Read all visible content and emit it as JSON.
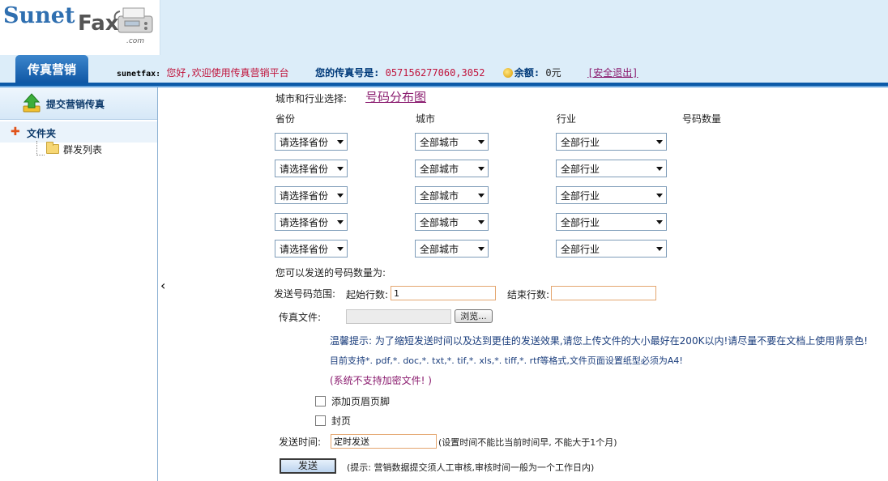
{
  "header": {
    "logo_primary": "Sunet",
    "logo_secondary": "Fax",
    "logo_suffix": ".com",
    "nav_tab": "传真营销",
    "username": "sunetfax:",
    "greeting": "您好,欢迎使用传真营销平台",
    "fax_number_label": "您的传真号是:",
    "fax_number_value": "057156277060,3052",
    "balance_label": "余额:",
    "balance_value": "0元",
    "logout": "[安全退出]"
  },
  "sidebar": {
    "submit_fax": "提交营销传真",
    "folder": "文件夹",
    "items": [
      "群发列表"
    ]
  },
  "form": {
    "selection_label": "城市和行业选择:",
    "map_link": "号码分布图",
    "columns": {
      "province": "省份",
      "city": "城市",
      "industry": "行业",
      "count": "号码数量"
    },
    "rows": [
      {
        "province": "请选择省份",
        "city": "全部城市",
        "industry": "全部行业"
      },
      {
        "province": "请选择省份",
        "city": "全部城市",
        "industry": "全部行业"
      },
      {
        "province": "请选择省份",
        "city": "全部城市",
        "industry": "全部行业"
      },
      {
        "province": "请选择省份",
        "city": "全部城市",
        "industry": "全部行业"
      },
      {
        "province": "请选择省份",
        "city": "全部城市",
        "industry": "全部行业"
      }
    ],
    "sendable_count_label": "您可以发送的号码数量为:",
    "range_label": "发送号码范围:",
    "start_row_label": "起始行数:",
    "start_row_value": "1",
    "end_row_label": "结束行数:",
    "end_row_value": "",
    "fax_file_label": "传真文件:",
    "browse_button": "浏览...",
    "tip_1": "温馨提示: 为了缩短发送时间以及达到更佳的发送效果,请您上传文件的大小最好在200K以内!请尽量不要在文档上使用背景色!",
    "tip_2": "目前支持*. pdf,*. doc,*. txt,*. tif,*. xls,*. tiff,*. rtf等格式,文件页面设置纸型必须为A4!",
    "tip_3": "(系统不支持加密文件! )",
    "checkbox_header_footer": "添加页眉页脚",
    "checkbox_cover": "封页",
    "send_time_label": "发送时间:",
    "send_time_value": "定时发送",
    "send_time_hint": "(设置时间不能比当前时间早, 不能大于1个月)",
    "send_button": "发送",
    "send_hint": "(提示: 营销数据提交须人工审核,审核时间一般为一个工作日内)"
  },
  "colors": {
    "header_bg": "#dcedf9",
    "nav_blue": "#0d5aa8",
    "accent_red": "#c0143c",
    "link_purple": "#8a1b6e"
  }
}
